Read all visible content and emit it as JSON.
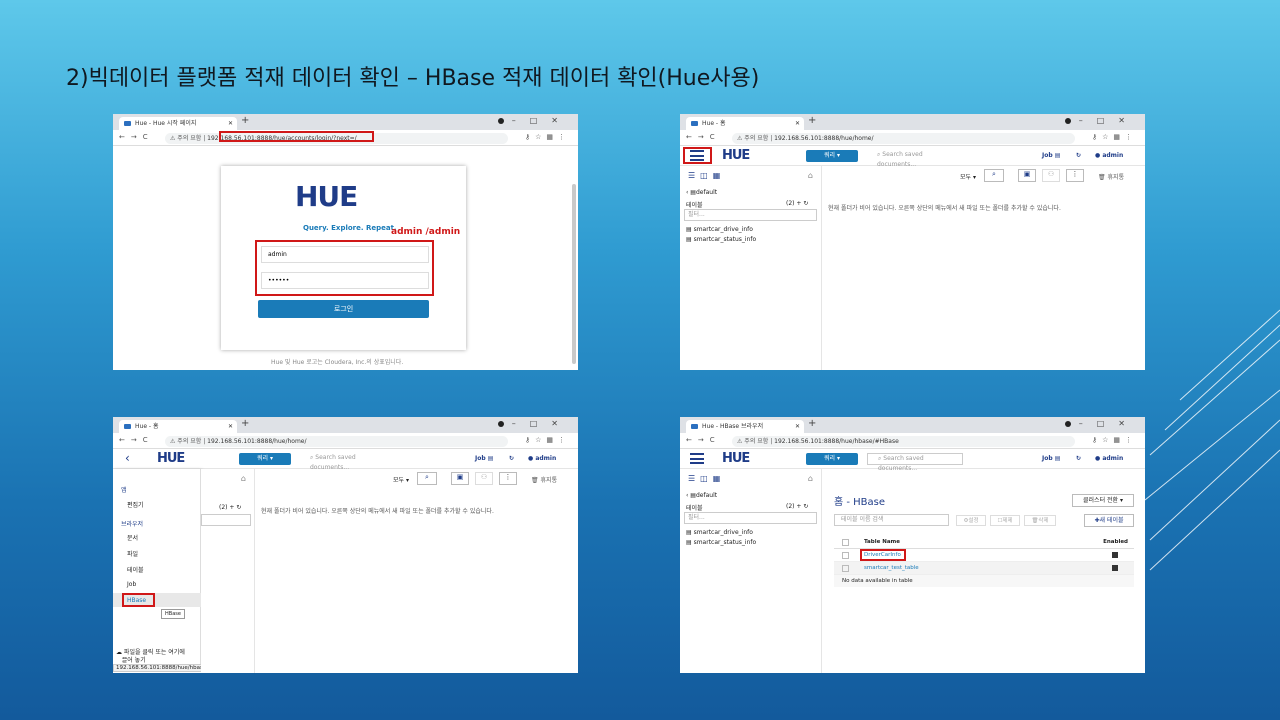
{
  "slide_title": "2)빅데이터 플랫폼 적재 데이터 확인 – HBase 적재 데이터 확인(Hue사용)",
  "colors": {
    "accent": "#1a7bb8",
    "highlight": "#d01818",
    "brand": "#1f3c88"
  },
  "browser": {
    "insecure_label": "주의 요함",
    "back_icon": "arrow-left-icon",
    "forward_icon": "arrow-right-icon",
    "reload_icon": "reload-icon"
  },
  "shot1": {
    "tab_title": "Hue - Hue 시작 페이지",
    "url": "192.168.56.101:8888/hue/accounts/login/?next=/",
    "logo": "HUE",
    "tagline": "Query. Explore. Repeat.",
    "annotation": "admin /admin",
    "username_value": "admin",
    "password_value": "••••••",
    "login_button": "로그인",
    "footer": "Hue 및 Hue 로고는 Cloudera, Inc.의 상표입니다."
  },
  "shot2": {
    "tab_title": "Hue - 홈",
    "url": "192.168.56.101:8888/hue/home/",
    "query_button": "쿼리",
    "search_placeholder": "Search saved documents...",
    "job_label": "Job",
    "user_label": "admin",
    "db_back": "default",
    "tables_label": "테이블",
    "tables_count": "(2)",
    "filter_placeholder": "필터...",
    "tables": [
      "smartcar_drive_info",
      "smartcar_status_info"
    ],
    "all_label": "모두",
    "trash_label": "휴지통",
    "empty_message": "현재 폴더가 비어 있습니다. 오른쪽 상단의 메뉴에서 새 파일 또는 폴더를 추가할 수 있습니다."
  },
  "shot3": {
    "tab_title": "Hue - 홈",
    "url": "192.168.56.101:8888/hue/home/",
    "query_button": "쿼리",
    "search_placeholder": "Search saved documents...",
    "job_label": "Job",
    "user_label": "admin",
    "menu_section_apps": "앱",
    "menu_editor": "편집기",
    "menu_section_browsers": "브라우저",
    "menu_docs": "문서",
    "menu_files": "파일",
    "menu_tables": "테이블",
    "menu_job": "Job",
    "menu_hbase": "HBase",
    "tooltip": "HBase",
    "tables_count": "(2)",
    "all_label": "모두",
    "trash_label": "휴지통",
    "empty_message": "현재 폴더가 비어 있습니다. 오른쪽 상단의 메뉴에서 새 파일 또는 폴더를 추가할 수 있습니다.",
    "upload_text_1": "파일을 클릭 또는 여기에",
    "upload_text_2": "끌어 놓기",
    "status_url": "192.168.56.101:8888/hue/hbase/"
  },
  "shot4": {
    "tab_title": "Hue - HBase 브라우저",
    "url": "192.168.56.101:8888/hue/hbase/#HBase",
    "query_button": "쿼리",
    "search_placeholder": "Search saved documents...",
    "job_label": "Job",
    "user_label": "admin",
    "db_back": "default",
    "tables_label": "테이블",
    "tables_count": "(2)",
    "filter_placeholder": "필터...",
    "tables": [
      "smartcar_drive_info",
      "smartcar_status_info"
    ],
    "page_title": "홈 - HBase",
    "cluster_button": "클러스터 전환",
    "table_search_placeholder": "테이블 이름 검색",
    "action_settings": "설정",
    "action_disable": "제제",
    "action_delete": "삭제",
    "new_table_button": "새 테이블",
    "col_name": "Table Name",
    "col_enabled": "Enabled",
    "rows": [
      "DriverCarInfo",
      "smartcar_test_table"
    ],
    "no_data": "No data available in table"
  }
}
